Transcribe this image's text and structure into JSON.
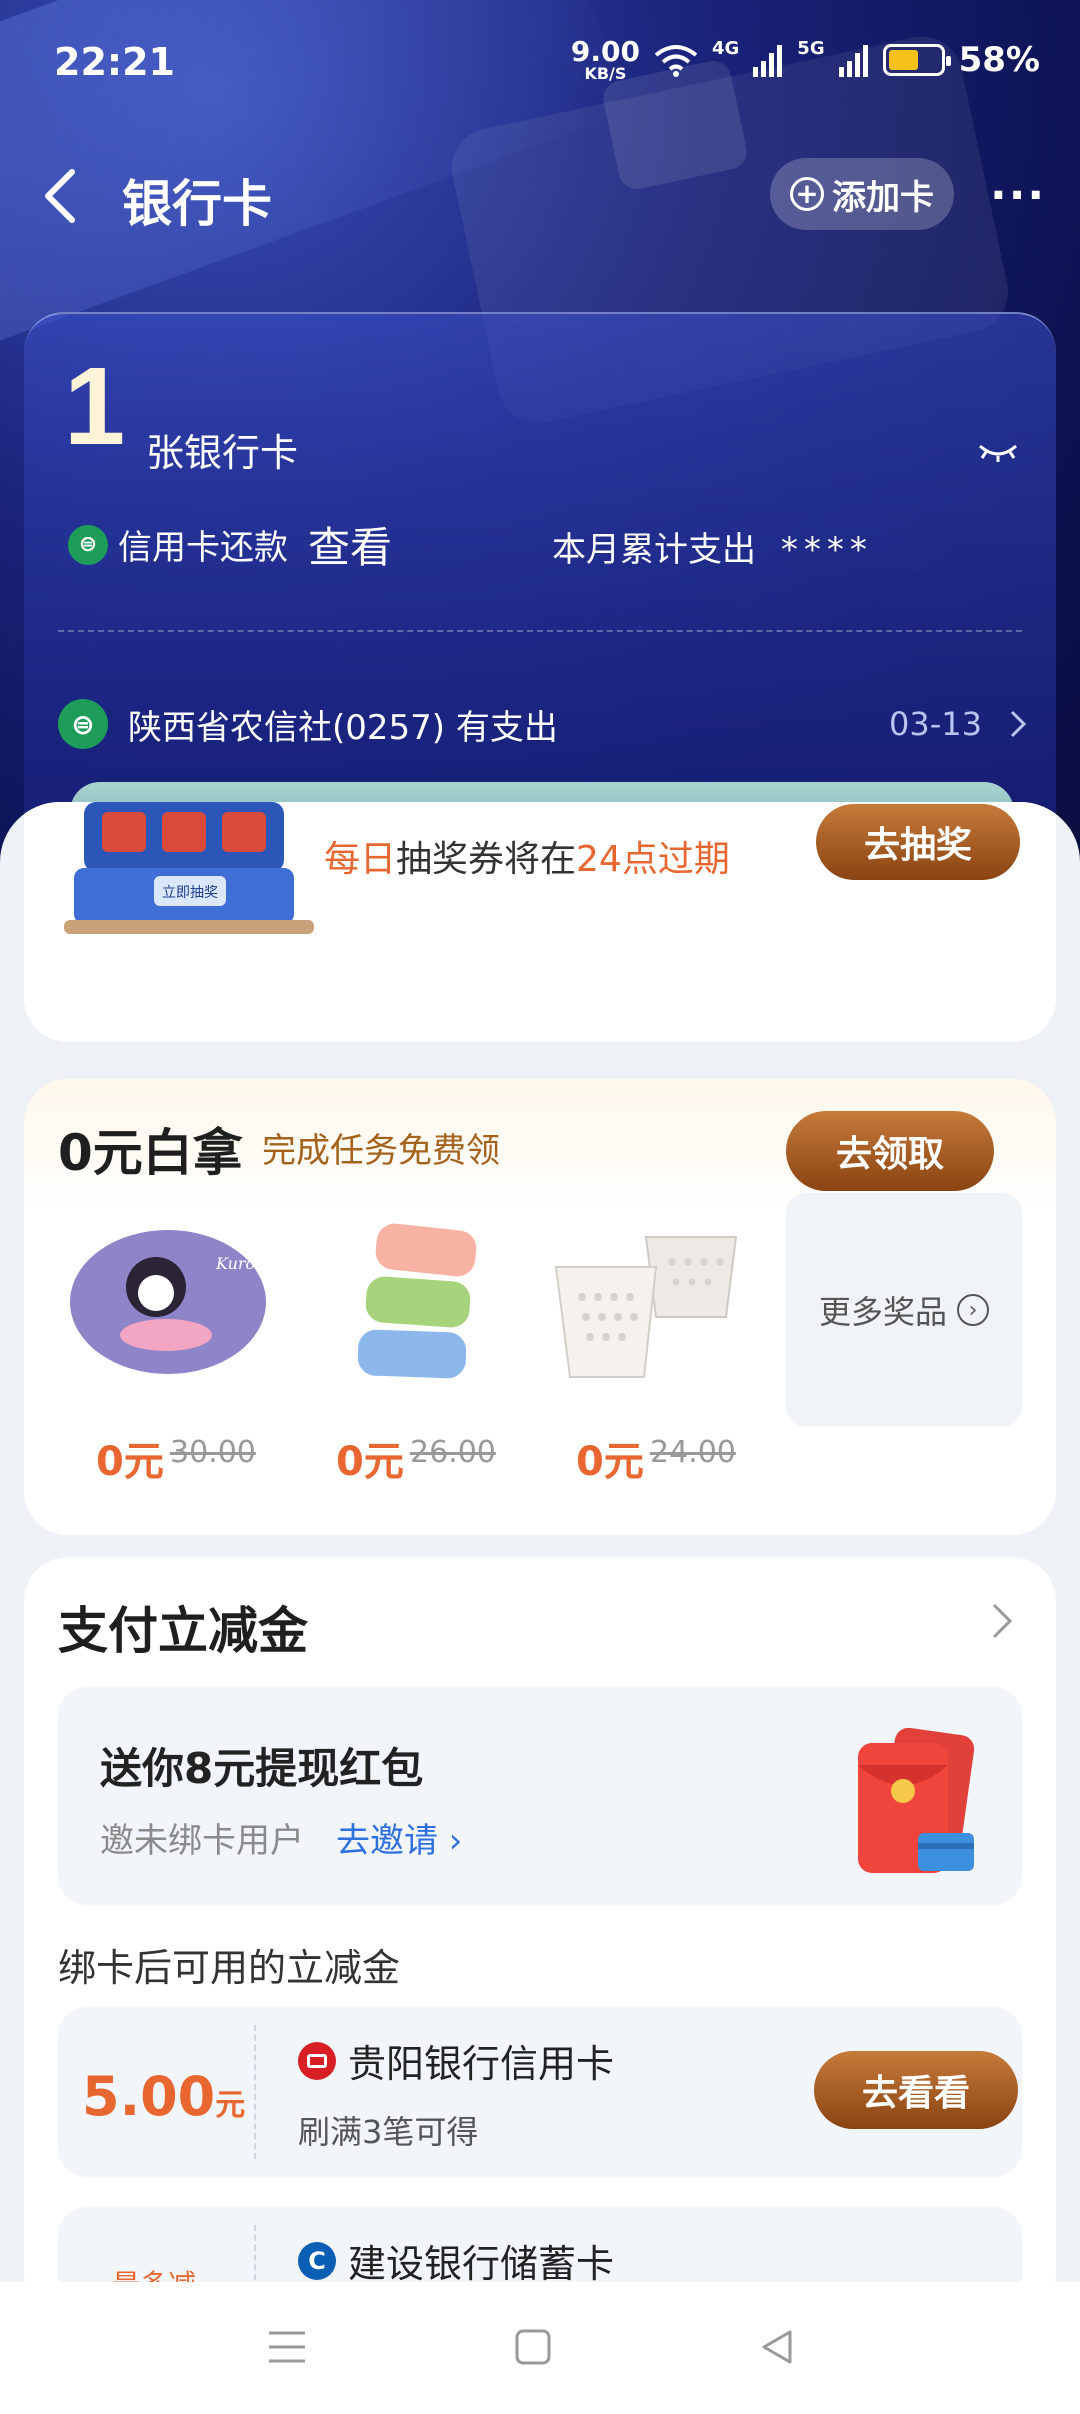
{
  "status_bar": {
    "time": "22:21",
    "speed_value": "9.00",
    "speed_unit": "KB/S",
    "net1": "4G",
    "net2": "5G",
    "battery": "58%",
    "battery_level": 0.58,
    "battery_color": "#f6c21a"
  },
  "header": {
    "title": "银行卡",
    "add_card": "添加卡",
    "more": "···"
  },
  "summary": {
    "card_count": "1",
    "count_label": "张银行卡",
    "repay_label": "信用卡还款",
    "repay_action": "查看",
    "month_spend_label": "本月累计支出",
    "month_spend_value": "****",
    "transaction": {
      "text": "陕西省农信社(0257) 有支出",
      "date": "03-13"
    }
  },
  "lottery": {
    "msg_part1": "每日",
    "msg_part2": "抽奖券将在",
    "msg_part3": "24点过期",
    "machine_label": "立即抽奖",
    "button": "去抽奖"
  },
  "free_gifts": {
    "title": "0元白拿",
    "subtitle": "完成任务免费领",
    "button": "去领取",
    "items": [
      {
        "price": "0元",
        "original": "30.00",
        "icon": "kuromi-mat-icon"
      },
      {
        "price": "0元",
        "original": "26.00",
        "icon": "towels-icon"
      },
      {
        "price": "0元",
        "original": "24.00",
        "icon": "laundry-basket-icon"
      }
    ],
    "more_label": "更多奖品"
  },
  "pay_discount": {
    "title": "支付立减金",
    "invite_title": "送你8元提现红包",
    "invite_desc": "邀未绑卡用户",
    "invite_link": "去邀请",
    "section_label": "绑卡后可用的立减金",
    "coupons": [
      {
        "amount": "5.00",
        "unit": "元",
        "bank": "贵阳银行信用卡",
        "condition": "刷满3笔可得",
        "button": "去看看"
      },
      {
        "amount_label": "最多减",
        "bank": "建设银行储蓄卡"
      }
    ]
  },
  "colors": {
    "accent_orange": "#e8662f",
    "button_brown": "#8a4412",
    "link_blue": "#2f6fe0",
    "hero_blue": "#1a237a"
  }
}
